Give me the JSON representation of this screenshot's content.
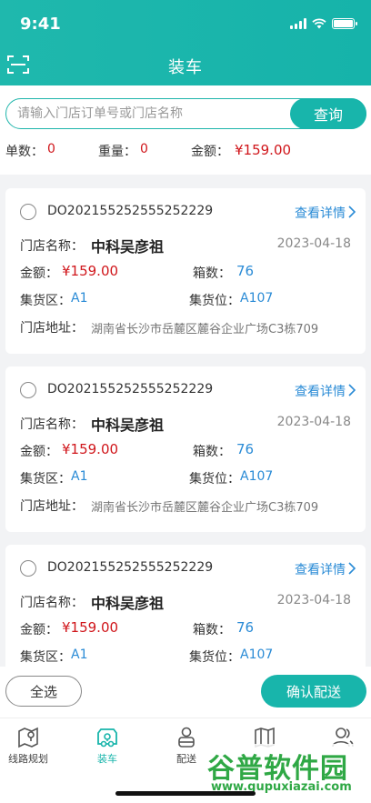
{
  "status_bar": {
    "time": "9:41"
  },
  "header": {
    "title": "装车",
    "scan_icon": "scan-icon"
  },
  "search": {
    "placeholder": "请输入门店订单号或门店名称",
    "value": "",
    "button_label": "查询"
  },
  "summary": {
    "count_label": "单数：",
    "count_value": "0",
    "weight_label": "重量：",
    "weight_value": "0",
    "amount_label": "金额：",
    "amount_value": "¥159.00"
  },
  "orders": [
    {
      "order_no": "DO202155252555252229",
      "detail_label": "查看详情",
      "store_label": "门店名称：",
      "store_name": "中科吴彦祖",
      "date": "2023-04-18",
      "amount_label": "金额：",
      "amount": "¥159.00",
      "boxes_label": "箱数：",
      "boxes": "76",
      "area_label": "集货区：",
      "area": "A1",
      "slot_label": "集货位：",
      "slot": "A107",
      "address_label": "门店地址：",
      "address": "湖南省长沙市岳麓区麓谷企业广场C3栋709"
    },
    {
      "order_no": "DO202155252555252229",
      "detail_label": "查看详情",
      "store_label": "门店名称：",
      "store_name": "中科吴彦祖",
      "date": "2023-04-18",
      "amount_label": "金额：",
      "amount": "¥159.00",
      "boxes_label": "箱数：",
      "boxes": "76",
      "area_label": "集货区：",
      "area": "A1",
      "slot_label": "集货位：",
      "slot": "A107",
      "address_label": "门店地址：",
      "address": "湖南省长沙市岳麓区麓谷企业广场C3栋709"
    },
    {
      "order_no": "DO202155252555252229",
      "detail_label": "查看详情",
      "store_label": "门店名称：",
      "store_name": "中科吴彦祖",
      "date": "2023-04-18",
      "amount_label": "金额：",
      "amount": "¥159.00",
      "boxes_label": "箱数：",
      "boxes": "76",
      "area_label": "集货区：",
      "area": "A1",
      "slot_label": "集货位：",
      "slot": "A107"
    }
  ],
  "actions": {
    "select_all": "全选",
    "confirm": "确认配送"
  },
  "tabs": [
    {
      "label": "线路规划",
      "icon": "route-map-icon",
      "active": false
    },
    {
      "label": "装车",
      "icon": "truck-loading-icon",
      "active": true
    },
    {
      "label": "配送",
      "icon": "courier-icon",
      "active": false
    },
    {
      "label": "",
      "icon": "map-icon",
      "active": false
    },
    {
      "label": "",
      "icon": "user-icon",
      "active": false
    }
  ],
  "watermark": {
    "text": "谷普软件园",
    "url": "www.gupuxiazai.com"
  },
  "colors": {
    "primary": "#18b5ab",
    "price": "#d0161b",
    "link": "#2a8bd6"
  }
}
